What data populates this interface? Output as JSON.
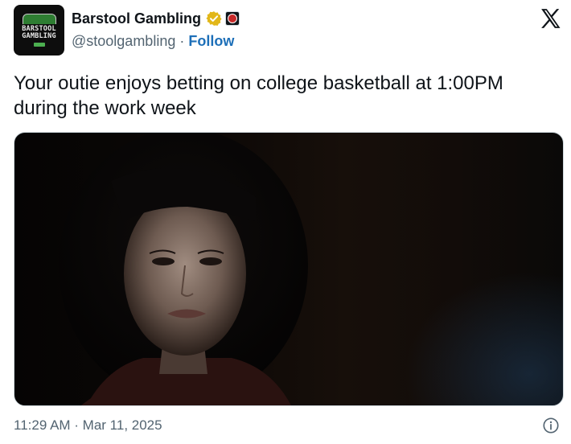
{
  "author": {
    "display_name": "Barstool Gambling",
    "handle": "@stoolgambling",
    "separator": "·",
    "follow_label": "Follow",
    "avatar_logo_line1": "BARSTOOL",
    "avatar_logo_line2": "GAMBLING",
    "verified_badge_color": "#e2b719",
    "avatar_icon": "barstool-gambling-logo",
    "affiliate_icon": "affiliate-badge-icon"
  },
  "platform_icon": "x-logo-icon",
  "tweet": {
    "text": "Your outie enjoys betting on college basketball at 1:00PM during the work week",
    "timestamp": "11:29 AM · Mar 11, 2025"
  },
  "media": {
    "kind": "photo",
    "subject": "woman-portrait-dark-background"
  },
  "colors": {
    "text_primary": "#0f1419",
    "text_secondary": "#536471",
    "link": "#1d6fb8"
  }
}
